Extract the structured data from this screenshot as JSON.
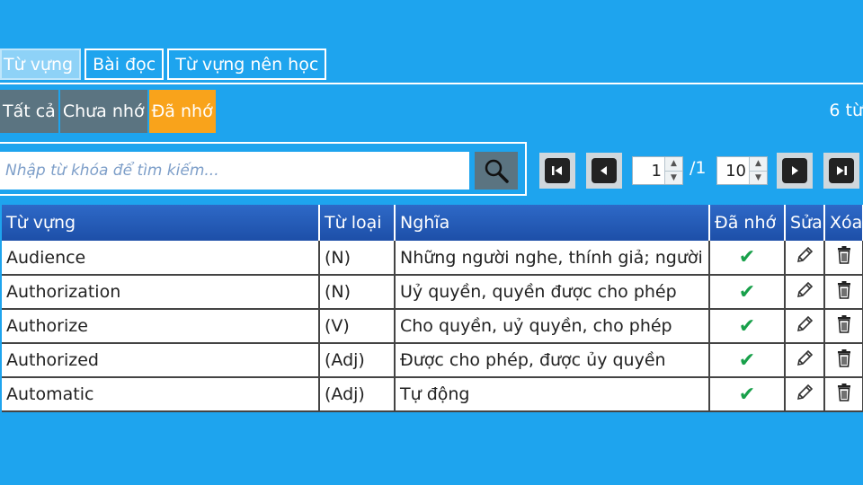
{
  "tabs": [
    {
      "label": "Từ vựng",
      "active": true
    },
    {
      "label": "Bài đọc",
      "active": false
    },
    {
      "label": "Từ vựng nên học",
      "active": false
    }
  ],
  "filters": [
    {
      "label": "Tất cả",
      "selected": false
    },
    {
      "label": "Chưa nhớ",
      "selected": false
    },
    {
      "label": "Đã nhớ",
      "selected": true
    }
  ],
  "count_text": "6 từ",
  "search": {
    "placeholder": "Nhập từ khóa để tìm kiếm...",
    "icon": "search-icon"
  },
  "pager": {
    "current_page": "1",
    "total_pages": "/1",
    "page_size": "10",
    "icons": [
      "first-page-icon",
      "prev-page-icon",
      "next-page-icon",
      "last-page-icon"
    ]
  },
  "table": {
    "headers": {
      "word": "Từ vựng",
      "type": "Từ loại",
      "meaning": "Nghĩa",
      "remembered": "Đã nhớ",
      "edit": "Sửa",
      "delete": "Xóa"
    },
    "rows": [
      {
        "word": "Audience",
        "type": "(N)",
        "meaning": "Những người nghe, thính giả; người",
        "remembered": "✔"
      },
      {
        "word": "Authorization",
        "type": "(N)",
        "meaning": "Uỷ quyền, quyền được cho phép",
        "remembered": "✔"
      },
      {
        "word": "Authorize",
        "type": "(V)",
        "meaning": "Cho quyền, uỷ quyền, cho phép",
        "remembered": "✔"
      },
      {
        "word": "Authorized",
        "type": "(Adj)",
        "meaning": "Được cho phép, được ủy quyền",
        "remembered": "✔"
      },
      {
        "word": "Automatic",
        "type": "(Adj)",
        "meaning": "Tự động",
        "remembered": "✔"
      }
    ]
  },
  "colors": {
    "background": "#1ea4ee",
    "filter_default": "#5b7481",
    "filter_selected": "#f9a31b",
    "header": "#1d4fa8",
    "check": "#18a04a"
  }
}
